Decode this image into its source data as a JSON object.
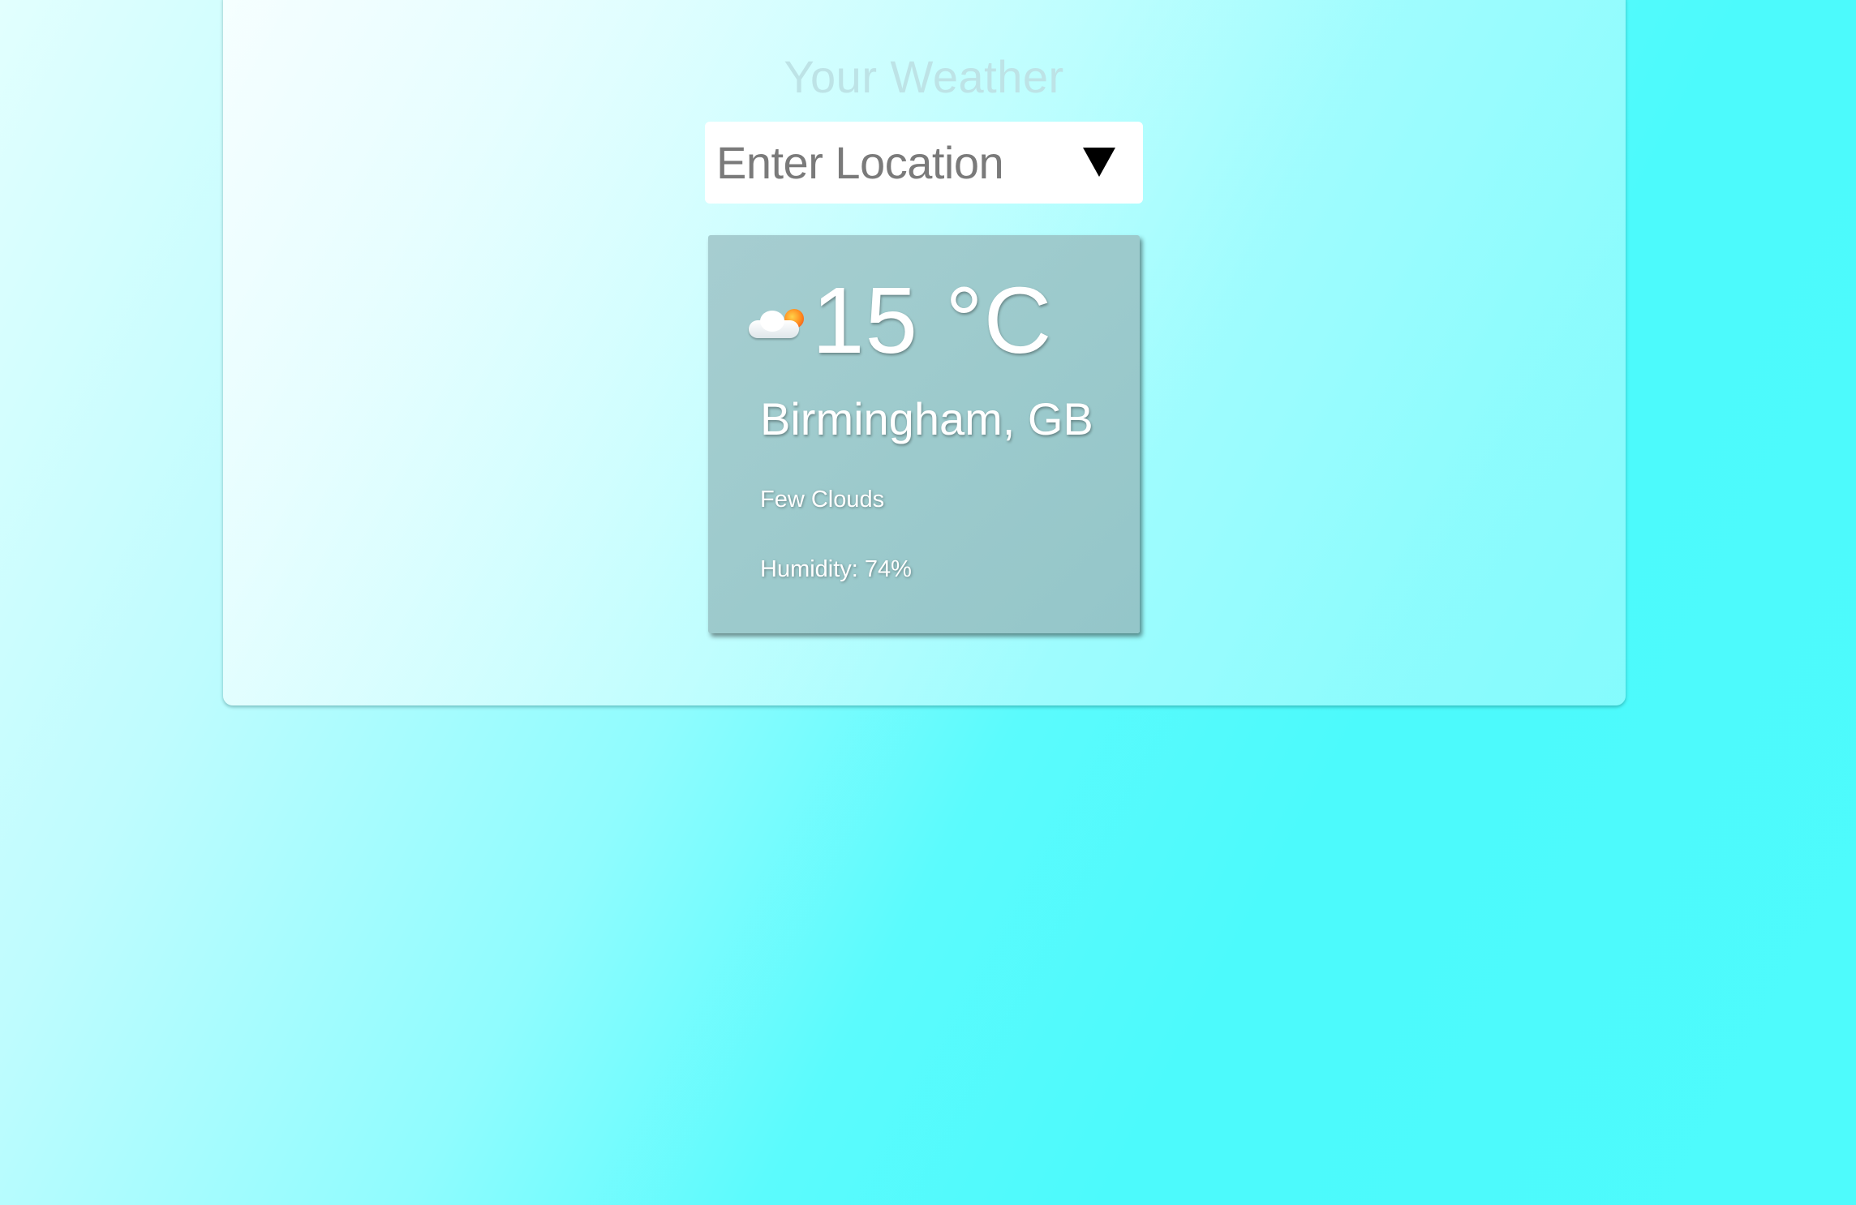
{
  "app": {
    "title": "Your Weather"
  },
  "search": {
    "placeholder": "Enter Location",
    "dropdown_icon": "triangle-down-icon"
  },
  "weather": {
    "icon": "few-clouds-icon",
    "temperature": "15 °C",
    "location": "Birmingham, GB",
    "description": "Few Clouds",
    "humidity": "Humidity: 74%"
  },
  "colors": {
    "background_light": "#e2fffe",
    "background_accent": "#4cfafc",
    "card": "#9ecbcd",
    "title": "#bde3e6"
  }
}
